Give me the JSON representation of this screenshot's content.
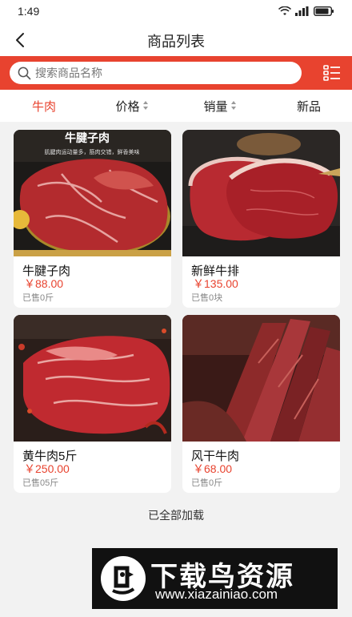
{
  "status_bar": {
    "time": "1:49",
    "battery_label": ""
  },
  "nav": {
    "title": "商品列表"
  },
  "search": {
    "placeholder": "搜索商品名称"
  },
  "filters": [
    {
      "label": "牛肉",
      "active": true,
      "sortable": false
    },
    {
      "label": "价格",
      "active": false,
      "sortable": true
    },
    {
      "label": "销量",
      "active": false,
      "sortable": true
    },
    {
      "label": "新品",
      "active": false,
      "sortable": false
    }
  ],
  "products": [
    {
      "name": "牛腱子肉",
      "price": "￥88.00",
      "sold": "已售0斤",
      "banner_title": "牛腱子肉",
      "banner_sub": "肌腱肉运动量多，筋肉交错，鲜香美味"
    },
    {
      "name": "新鲜牛排",
      "price": "￥135.00",
      "sold": "已售0块"
    },
    {
      "name": "黄牛肉5斤",
      "price": "￥250.00",
      "sold": "已售05斤"
    },
    {
      "name": "风干牛肉",
      "price": "￥68.00",
      "sold": "已售0斤"
    }
  ],
  "footer": {
    "load_all": "已全部加载"
  },
  "watermark": {
    "text": "下载鸟资源",
    "url": "www.xiazainiao.com"
  },
  "colors": {
    "accent": "#e8432f",
    "price": "#e8432f",
    "background": "#f2f2f2"
  }
}
